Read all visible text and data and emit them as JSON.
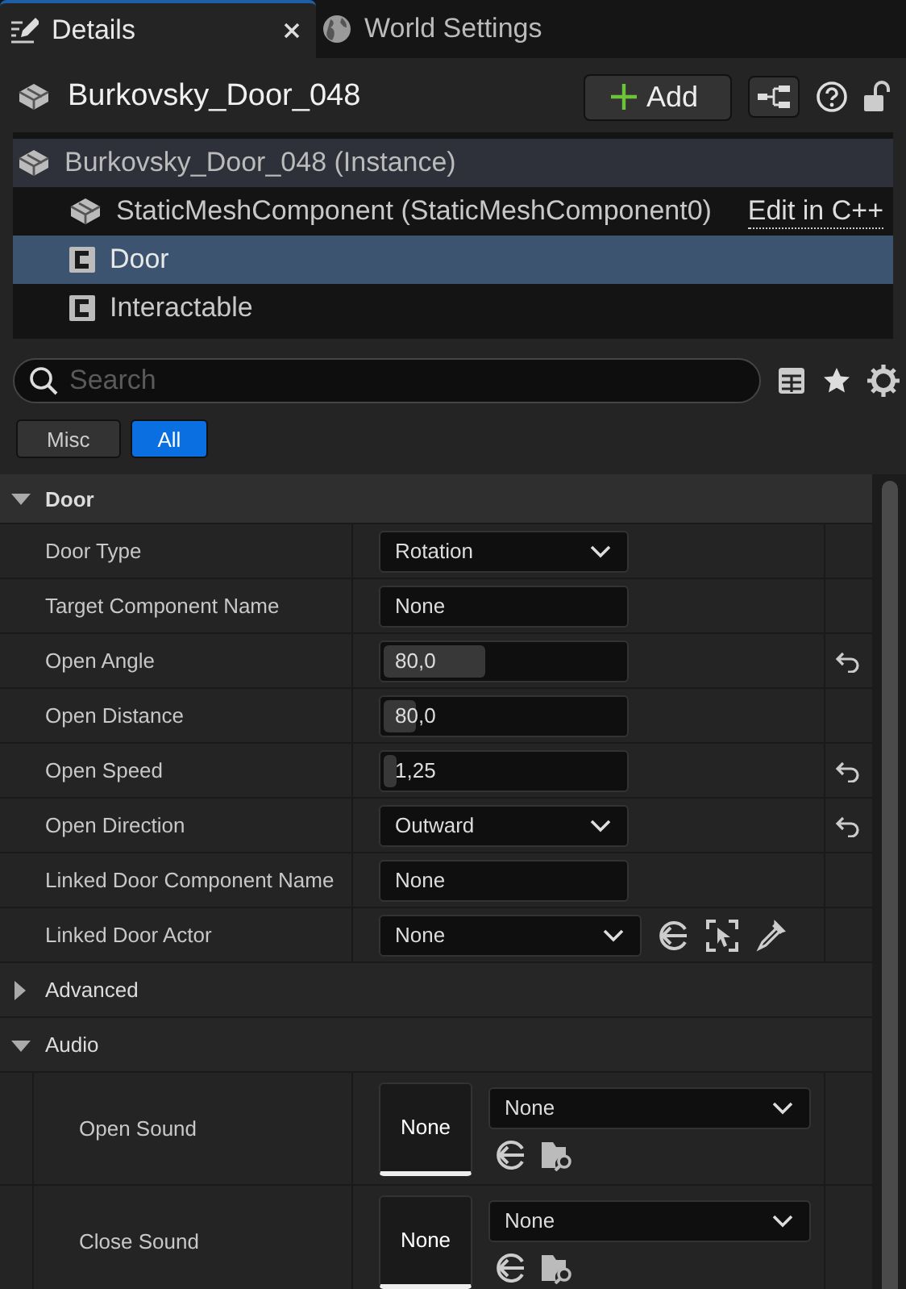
{
  "tabs": [
    {
      "label": "Details",
      "kind": "details",
      "selected": true,
      "closable": true
    },
    {
      "label": "World Settings",
      "kind": "globe",
      "selected": false,
      "closable": false
    }
  ],
  "header": {
    "title": "Burkovsky_Door_048",
    "add_button": "Add"
  },
  "components": {
    "label": "Burkovsky_Door_048 (Instance)",
    "kind": "mesh",
    "selected": false,
    "children": [
      {
        "label": "StaticMeshComponent (StaticMeshComponent0)",
        "kind": "mesh",
        "selected": false,
        "link": "Edit in C++"
      },
      {
        "label": "Door",
        "kind": "class",
        "selected": true
      },
      {
        "label": "Interactable",
        "kind": "class",
        "selected": false
      }
    ]
  },
  "search": {
    "placeholder": "Search"
  },
  "filters": [
    {
      "label": "Misc",
      "selected": false
    },
    {
      "label": "All",
      "selected": true
    }
  ],
  "sections": [
    {
      "title": "Door",
      "kind": "category",
      "expanded": true,
      "properties": [
        {
          "kind": "combo",
          "name": "Door Type",
          "value": "Rotation",
          "resettable": false
        },
        {
          "kind": "text",
          "name": "Target Component Name",
          "value": "None",
          "resettable": false
        },
        {
          "kind": "number",
          "name": "Open Angle",
          "value": "80,0",
          "level": 0.42,
          "resettable": true
        },
        {
          "kind": "number",
          "name": "Open Distance",
          "value": "80,0",
          "level": 0.13,
          "resettable": false
        },
        {
          "kind": "number",
          "name": "Open Speed",
          "value": "1,25",
          "level": 0.05,
          "resettable": true
        },
        {
          "kind": "combo",
          "name": "Open Direction",
          "value": "Outward",
          "resettable": true
        },
        {
          "kind": "text",
          "name": "Linked Door Component Name",
          "value": "None",
          "resettable": false
        },
        {
          "kind": "actor",
          "name": "Linked Door Actor",
          "value": "None",
          "resettable": false
        }
      ]
    },
    {
      "title": "Advanced",
      "kind": "subcategory",
      "expanded": false
    },
    {
      "title": "Audio",
      "kind": "subcategory",
      "expanded": true,
      "properties": [
        {
          "kind": "sound",
          "name": "Open Sound",
          "thumbnail": "None",
          "value": "None",
          "resettable": false
        },
        {
          "kind": "sound",
          "name": "Close Sound",
          "thumbnail": "None",
          "value": "None",
          "resettable": false
        }
      ]
    }
  ]
}
